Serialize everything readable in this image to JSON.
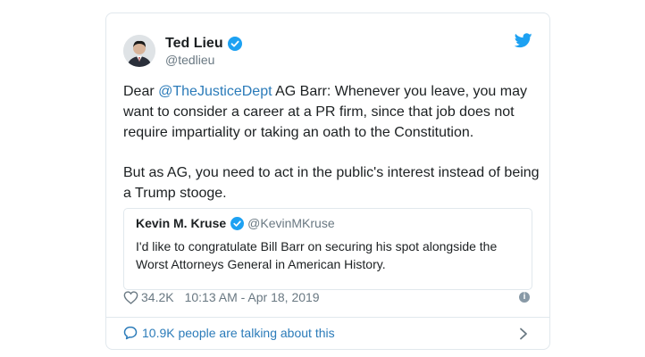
{
  "tweet": {
    "author_name": "Ted Lieu",
    "author_handle": "@tedlieu",
    "text_p1_prefix": "Dear ",
    "text_p1_mention": "@TheJusticeDept",
    "text_p1_rest": " AG Barr: Whenever you leave, you may want to consider a career at a PR firm, since that job does not require impartiality or taking an oath to the Constitution.",
    "text_p2": "But as AG, you need to act in the public's interest instead of being a Trump stooge.",
    "likes": "34.2K",
    "timestamp": "10:13 AM - Apr 18, 2019",
    "talking": "10.9K people are talking about this"
  },
  "quoted_tweet": {
    "author_name": "Kevin M. Kruse",
    "author_handle": "@KevinMKruse",
    "text": "I'd like to congratulate Bill Barr on securing his spot alongside the Worst Attorneys General in American History."
  },
  "icons": {
    "verified": "verified-badge-icon",
    "brand": "twitter-bird-icon",
    "like": "heart-icon",
    "info": "info-icon",
    "reply": "speech-bubble-icon",
    "more": "chevron-right-icon"
  },
  "colors": {
    "link": "#2b7bb9",
    "verified": "#1da1f2",
    "muted": "#697882",
    "border": "#e1e8ed"
  }
}
